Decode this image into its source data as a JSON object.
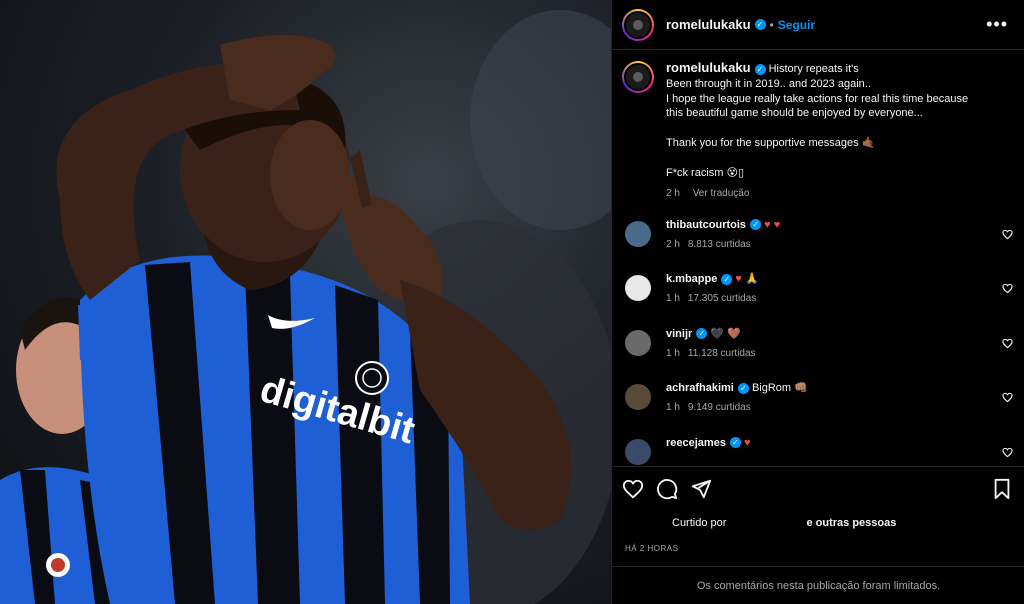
{
  "post": {
    "author": "romelulukaku",
    "separator": "•",
    "follow_label": "Seguir",
    "more_icon": "more-horizontal-icon",
    "photo_text": "digitalbit",
    "caption": {
      "line1": "History repeats it's",
      "line2": "Been through it in 2019.. and 2023 again..",
      "line3": "I hope the league really take actions for real this time because",
      "line4": "this beautiful game should be enjoyed by everyone...",
      "line5": "Thank you for the supportive messages 🤙🏾",
      "line6": "F*ck racism 😵▯",
      "time": "2 h",
      "translate": "Ver tradução"
    }
  },
  "comments": [
    {
      "user": "thibautcourtois",
      "text": "♥ ♥",
      "time": "2 h",
      "likes": "8.813 curtidas",
      "avatar_color": "#4a6a8a"
    },
    {
      "user": "k.mbappe",
      "text": "♥ 🙏",
      "time": "1 h",
      "likes": "17.305 curtidas",
      "avatar_color": "#e8e8e8"
    },
    {
      "user": "vinijr",
      "text": "🖤 🤎",
      "time": "1 h",
      "likes": "11.128 curtidas",
      "avatar_color": "#6a6a6a"
    },
    {
      "user": "achrafhakimi",
      "text": "BigRom 👊🏽",
      "time": "1 h",
      "likes": "9.149 curtidas",
      "avatar_color": "#5a4a3a"
    },
    {
      "user": "reecejames",
      "text": "♥",
      "time": "",
      "likes": "",
      "avatar_color": "#3a4a6a"
    }
  ],
  "footer": {
    "liked_by": "Curtido por",
    "others": "e outras pessoas",
    "timestamp": "HÁ 2 HORAS",
    "comments_limited": "Os comentários nesta publicação foram limitados."
  },
  "colors": {
    "accent": "#0095f6",
    "heart": "#ed4956",
    "jersey_blue": "#1f5fd6",
    "jersey_black": "#0b0b14"
  }
}
